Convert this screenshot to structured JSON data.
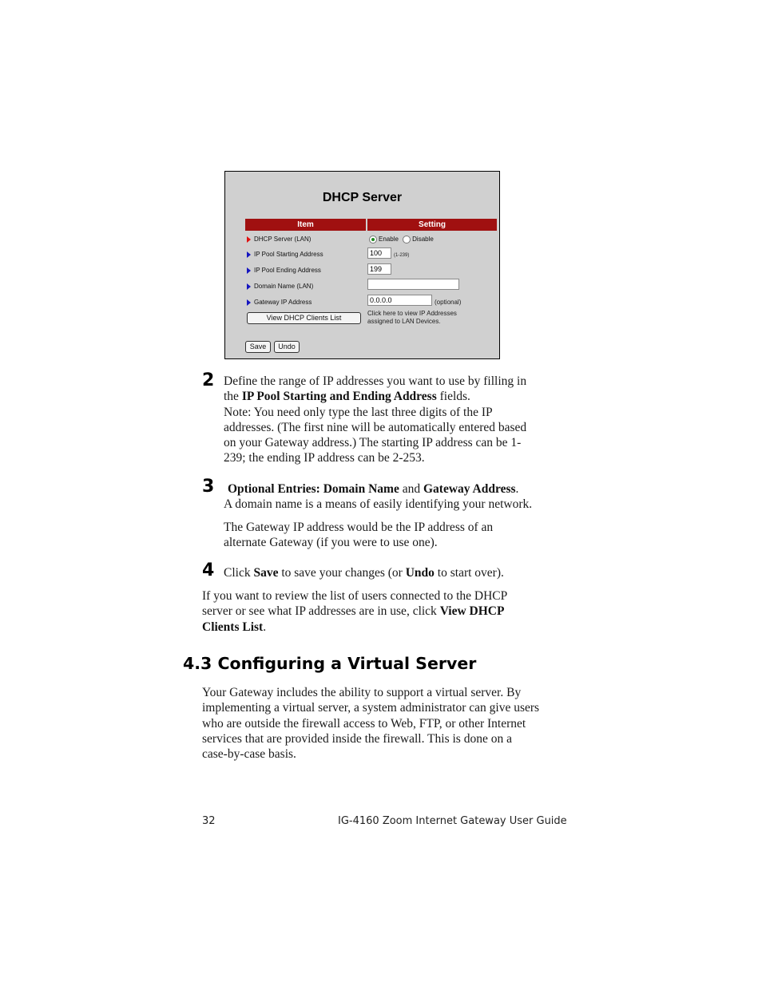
{
  "screenshot": {
    "title": "DHCP Server",
    "columns": [
      "Item",
      "Setting"
    ],
    "rows": [
      {
        "label": "DHCP Server (LAN)",
        "arrow_color": "#e01010"
      },
      {
        "label": "IP Pool Starting Address",
        "arrow_color": "#1515c0"
      },
      {
        "label": "IP Pool Ending Address",
        "arrow_color": "#1515c0"
      },
      {
        "label": "Domain Name (LAN)",
        "arrow_color": "#1515c0"
      },
      {
        "label": "Gateway IP Address",
        "arrow_color": "#1515c0"
      }
    ],
    "radio_enable": "Enable",
    "radio_disable": "Disable",
    "radio_selected": "Enable",
    "start_value": "100",
    "start_hint": "(1-239)",
    "end_value": "199",
    "domain_value": "",
    "gateway_value": "0.0.0.0",
    "gateway_hint": "(optional)",
    "view_clients_button": "View DHCP Clients List",
    "view_clients_info_line1": "Click here to view IP Addresses",
    "view_clients_info_line2": "assigned to LAN Devices.",
    "save_button": "Save",
    "undo_button": "Undo",
    "header_color": "#a01010"
  },
  "steps": {
    "step2": {
      "number": "2",
      "l1": "Define the range of IP addresses you want to use by filling in",
      "l2_pre": "the ",
      "l2_bold": "IP Pool Starting and Ending Address",
      "l2_post": " fields.",
      "l3": "Note: You need only type the last three digits of the IP",
      "l4": "addresses. (The first nine will be automatically entered based",
      "l5": "on your Gateway address.) The starting IP address can be 1-",
      "l6": "239; the ending IP address can be 2-253."
    },
    "step3": {
      "number": "3",
      "bold1": "Optional Entries: Domain Name",
      "mid": " and ",
      "bold2": "Gateway Address",
      "end": ".",
      "l2": "A domain name is a means of easily identifying your network.",
      "p2l1": "The Gateway IP address would be the IP address of an",
      "p2l2": "alternate Gateway (if you were to use one)."
    },
    "step4": {
      "number": "4",
      "pre": "Click ",
      "bold1": "Save",
      "mid": " to save your changes (or ",
      "bold2": "Undo",
      "post": " to start over)."
    }
  },
  "review": {
    "l1": "If you want to review the list of users connected to the DHCP",
    "l2_pre": "server or see what IP addresses are in use, click ",
    "l2_bold": "View DHCP",
    "l3_bold": "Clients List",
    "l3_post": "."
  },
  "section": {
    "heading": "4.3 Configuring a Virtual Server",
    "lines": [
      "Your Gateway includes the ability to support a virtual server. By",
      "implementing a virtual server, a system administrator can give users",
      "who are outside the firewall access to Web, FTP, or other Internet",
      "services that are provided inside the firewall. This is done on a",
      "case-by-case basis."
    ]
  },
  "footer": {
    "page_number": "32",
    "guide_title": "IG-4160 Zoom Internet Gateway User Guide"
  }
}
